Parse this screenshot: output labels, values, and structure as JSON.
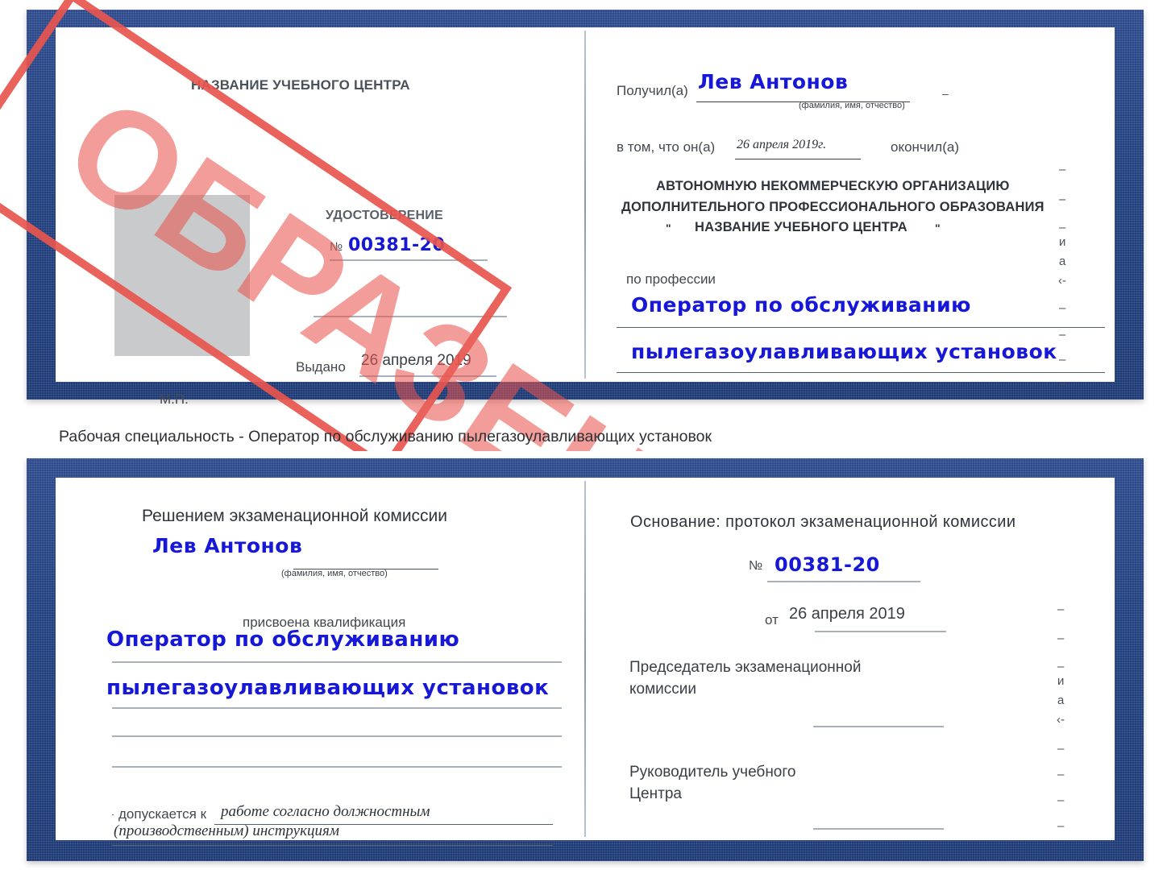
{
  "caption": "Рабочая специальность - Оператор по обслуживанию пылегазоулавливающих установок",
  "colors": {
    "cover_blue": "#21407f",
    "stamp_red": "#e8554e",
    "handwriting_blue": "#1717d8",
    "rule_gray": "#a9b0b8",
    "photo_placeholder": "#c8cacb"
  },
  "stamp": {
    "label": "ОБРАЗЕЦ"
  },
  "certificate": {
    "front": {
      "org_title": "НАЗВАНИЕ УЧЕБНОГО ЦЕНТРА",
      "doc_type": "УДОСТОВЕРЕНИЕ",
      "number_symbol": "№",
      "number_value": "00381-20",
      "issued_label": "Выдано",
      "issued_value": "26 апреля 2019",
      "seal_label": "М.П."
    },
    "inside_right": {
      "received_label": "Получил(а)",
      "received_value": "Лев Антонов",
      "fio_hint": "(фамилия, имя, отчество)",
      "in_that_label": "в том, что он(а)",
      "completion_date": "26 апреля 2019г.",
      "finished_label": "окончил(а)",
      "org_line1": "АВТОНОМНУЮ НЕКОММЕРЧЕСКУЮ ОРГАНИЗАЦИЮ",
      "org_line2": "ДОПОЛНИТЕЛЬНОГО ПРОФЕССИОНАЛЬНОГО ОБРАЗОВАНИЯ",
      "org_quote_open": "\"",
      "org_line3": "НАЗВАНИЕ УЧЕБНОГО ЦЕНТРА",
      "org_quote_close": "\"",
      "profession_label": "по профессии",
      "profession_line1": "Оператор по обслуживанию",
      "profession_line2": "пылегазоулавливающих установок",
      "edge_marks": [
        "–",
        "–",
        "–",
        "и",
        "а",
        "‹-",
        "–",
        "–",
        "–",
        "–"
      ]
    }
  },
  "certificate2": {
    "left": {
      "commission_title": "Решением экзаменационной комиссии",
      "name_value": "Лев Антонов",
      "fio_hint": "(фамилия, имя, отчество)",
      "qualification_label": "присвоена квалификация",
      "qualification_line1": "Оператор по обслуживанию",
      "qualification_line2": "пылегазоулавливающих установок",
      "allowed_label": "допускается к",
      "allowed_value1": "работе согласно должностным",
      "allowed_value2": "(производственным) инструкциям"
    },
    "right": {
      "basis_label": "Основание: протокол экзаменационной комиссии",
      "number_symbol": "№",
      "number_value": "00381-20",
      "from_label": "от",
      "from_value": "26 апреля 2019",
      "chairman_line1": "Председатель экзаменационной",
      "chairman_line2": "комиссии",
      "head_line1": "Руководитель учебного",
      "head_line2": "Центра",
      "edge_marks": [
        "–",
        "–",
        "–",
        "и",
        "а",
        "‹-",
        "–",
        "–",
        "–",
        "–"
      ]
    }
  }
}
